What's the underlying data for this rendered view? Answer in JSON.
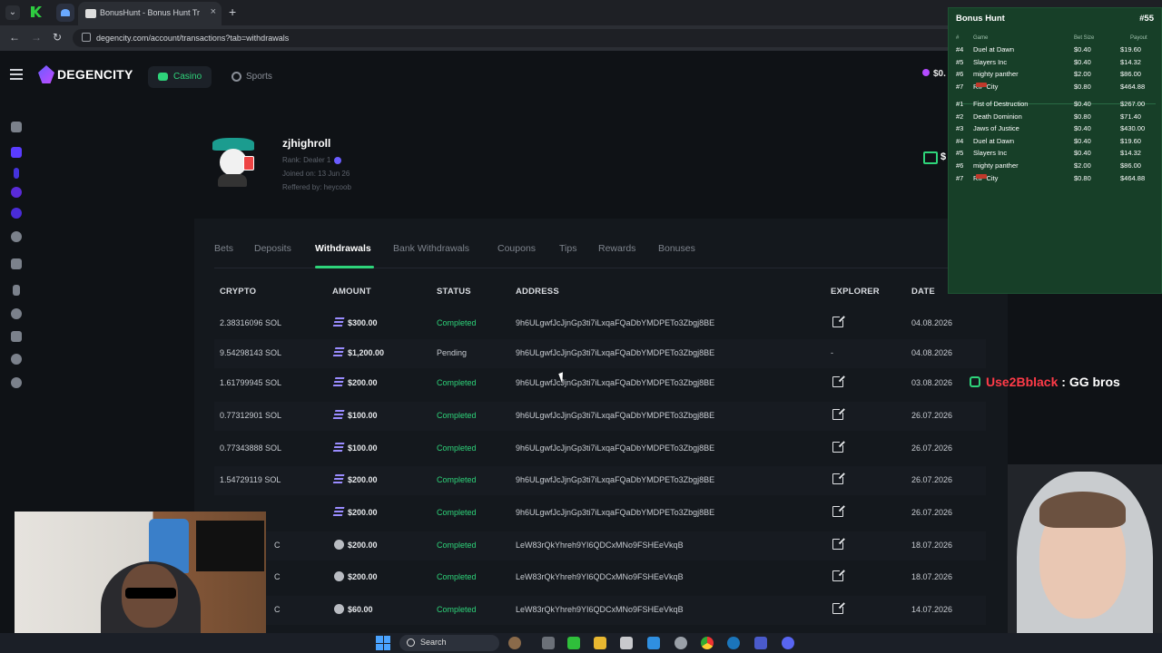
{
  "browser": {
    "tab_title": "BonusHunt - Bonus Hunt Track",
    "tab_close": "×",
    "new_tab": "+",
    "url": "degencity.com/account/transactions?tab=withdrawals",
    "nav_back": "←",
    "nav_forward": "→",
    "nav_reload": "↻"
  },
  "site": {
    "logo": "DEGENCITY",
    "nav_casino": "Casino",
    "nav_sports": "Sports",
    "balance": "$0.",
    "wallet_amount": "$"
  },
  "profile": {
    "username": "zjhighroll",
    "rank": "Rank: Dealer 1",
    "joined": "Joined on: 13 Jun 26",
    "referred": "Reffered by: heycoob"
  },
  "tabs": [
    "Bets",
    "Deposits",
    "Withdrawals",
    "Bank Withdrawals",
    "Coupons",
    "Tips",
    "Rewards",
    "Bonuses"
  ],
  "active_tab": "Withdrawals",
  "table": {
    "headers": [
      "CRYPTO",
      "AMOUNT",
      "STATUS",
      "ADDRESS",
      "EXPLORER",
      "DATE"
    ],
    "rows": [
      {
        "crypto": "2.38316096 SOL",
        "coin": "sol",
        "amount": "$300.00",
        "status": "Completed",
        "address": "9h6ULgwfJcJjnGp3ti7iLxqaFQaDbYMDPETo3Zbgj8BE",
        "explorer": "link",
        "date": "04.08.2026"
      },
      {
        "crypto": "9.54298143 SOL",
        "coin": "sol",
        "amount": "$1,200.00",
        "status": "Pending",
        "address": "9h6ULgwfJcJjnGp3ti7iLxqaFQaDbYMDPETo3Zbgj8BE",
        "explorer": "-",
        "date": "04.08.2026"
      },
      {
        "crypto": "1.61799945 SOL",
        "coin": "sol",
        "amount": "$200.00",
        "status": "Completed",
        "address": "9h6ULgwfJcJjnGp3ti7iLxqaFQaDbYMDPETo3Zbgj8BE",
        "explorer": "link",
        "date": "03.08.2026"
      },
      {
        "crypto": "0.77312901 SOL",
        "coin": "sol",
        "amount": "$100.00",
        "status": "Completed",
        "address": "9h6ULgwfJcJjnGp3ti7iLxqaFQaDbYMDPETo3Zbgj8BE",
        "explorer": "link",
        "date": "26.07.2026"
      },
      {
        "crypto": "0.77343888 SOL",
        "coin": "sol",
        "amount": "$100.00",
        "status": "Completed",
        "address": "9h6ULgwfJcJjnGp3ti7iLxqaFQaDbYMDPETo3Zbgj8BE",
        "explorer": "link",
        "date": "26.07.2026"
      },
      {
        "crypto": "1.54729119 SOL",
        "coin": "sol",
        "amount": "$200.00",
        "status": "Completed",
        "address": "9h6ULgwfJcJjnGp3ti7iLxqaFQaDbYMDPETo3Zbgj8BE",
        "explorer": "link",
        "date": "26.07.2026"
      },
      {
        "crypto": "",
        "coin": "sol",
        "amount": "$200.00",
        "status": "Completed",
        "address": "9h6ULgwfJcJjnGp3ti7iLxqaFQaDbYMDPETo3Zbgj8BE",
        "explorer": "link",
        "date": "26.07.2026"
      },
      {
        "crypto": "C",
        "coin": "ltc",
        "amount": "$200.00",
        "status": "Completed",
        "address": "LeW83rQkYhreh9YI6QDCxMNo9FSHEeVkqB",
        "explorer": "link",
        "date": "18.07.2026"
      },
      {
        "crypto": "C",
        "coin": "ltc",
        "amount": "$200.00",
        "status": "Completed",
        "address": "LeW83rQkYhreh9YI6QDCxMNo9FSHEeVkqB",
        "explorer": "link",
        "date": "18.07.2026"
      },
      {
        "crypto": "C",
        "coin": "ltc",
        "amount": "$60.00",
        "status": "Completed",
        "address": "LeW83rQkYhreh9YI6QDCxMNo9FSHEeVkqB",
        "explorer": "link",
        "date": "14.07.2026"
      }
    ]
  },
  "bonus_hunt": {
    "title": "Bonus Hunt",
    "number": "#55",
    "headers": [
      "#",
      "Game",
      "Bet Size",
      "Payout"
    ],
    "top": [
      {
        "rank": "#4",
        "game": "Duel at Dawn",
        "bet": "$0.40",
        "payout": "$19.60",
        "tag": false
      },
      {
        "rank": "#5",
        "game": "Slayers Inc",
        "bet": "$0.40",
        "payout": "$14.32",
        "tag": false
      },
      {
        "rank": "#6",
        "game": "mighty panther",
        "bet": "$2.00",
        "payout": "$86.00",
        "tag": false
      },
      {
        "rank": "#7",
        "game": "RIP City",
        "bet": "$0.80",
        "payout": "$464.88",
        "tag": true
      }
    ],
    "list": [
      {
        "rank": "#1",
        "game": "Fist of Destruction",
        "bet": "$0.40",
        "payout": "$267.00",
        "tag": false
      },
      {
        "rank": "#2",
        "game": "Death Dominion",
        "bet": "$0.80",
        "payout": "$71.40",
        "tag": false
      },
      {
        "rank": "#3",
        "game": "Jaws of Justice",
        "bet": "$0.40",
        "payout": "$430.00",
        "tag": false
      },
      {
        "rank": "#4",
        "game": "Duel at Dawn",
        "bet": "$0.40",
        "payout": "$19.60",
        "tag": false
      },
      {
        "rank": "#5",
        "game": "Slayers Inc",
        "bet": "$0.40",
        "payout": "$14.32",
        "tag": false
      },
      {
        "rank": "#6",
        "game": "mighty panther",
        "bet": "$2.00",
        "payout": "$86.00",
        "tag": false
      },
      {
        "rank": "#7",
        "game": "RIP City",
        "bet": "$0.80",
        "payout": "$464.88",
        "tag": true
      }
    ]
  },
  "chat": {
    "user": "Use2Bblack",
    "message": ": GG bros"
  },
  "taskbar": {
    "search": "Search"
  },
  "colors": {
    "accent": "#2ed47a",
    "overlay": "#173f28",
    "chat_user": "#ff3b48"
  }
}
